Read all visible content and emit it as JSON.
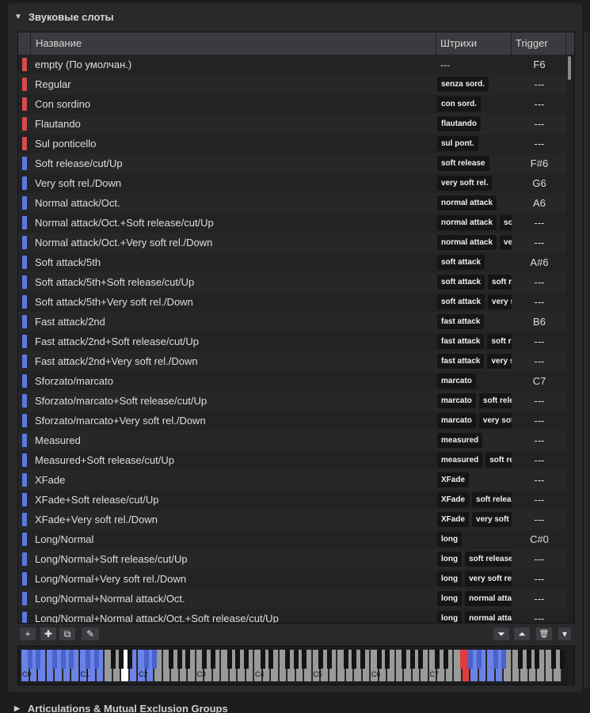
{
  "section": {
    "title": "Звуковые слоты",
    "arrow": "▼"
  },
  "table": {
    "headers": {
      "name": "Название",
      "strokes": "Штрихи",
      "trigger": "Trigger"
    },
    "rows": [
      {
        "color": "#d94a4a",
        "name": "empty (По умолчан.)",
        "strokes": [
          "---"
        ],
        "trigger": "F6"
      },
      {
        "color": "#d94a4a",
        "name": "Regular",
        "strokes": [
          "senza sord."
        ],
        "trigger": "---"
      },
      {
        "color": "#d94a4a",
        "name": "Con sordino",
        "strokes": [
          "con sord."
        ],
        "trigger": "---"
      },
      {
        "color": "#d94a4a",
        "name": "Flautando",
        "strokes": [
          "flautando"
        ],
        "trigger": "---"
      },
      {
        "color": "#d94a4a",
        "name": "Sul ponticello",
        "strokes": [
          "sul pont."
        ],
        "trigger": "---"
      },
      {
        "color": "#5b78e0",
        "name": "Soft release/cut/Up",
        "strokes": [
          "soft release"
        ],
        "trigger": "F#6"
      },
      {
        "color": "#5b78e0",
        "name": "Very soft rel./Down",
        "strokes": [
          "very soft rel."
        ],
        "trigger": "G6"
      },
      {
        "color": "#5b78e0",
        "name": "Normal attack/Oct.",
        "strokes": [
          "normal attack"
        ],
        "trigger": "A6"
      },
      {
        "color": "#5b78e0",
        "name": "Normal attack/Oct.+Soft release/cut/Up",
        "strokes": [
          "normal attack",
          "soft release"
        ],
        "trigger": "---"
      },
      {
        "color": "#5b78e0",
        "name": "Normal attack/Oct.+Very soft rel./Down",
        "strokes": [
          "normal attack",
          "very soft rel."
        ],
        "trigger": "---"
      },
      {
        "color": "#5b78e0",
        "name": "Soft attack/5th",
        "strokes": [
          "soft attack"
        ],
        "trigger": "A#6"
      },
      {
        "color": "#5b78e0",
        "name": "Soft attack/5th+Soft release/cut/Up",
        "strokes": [
          "soft attack",
          "soft release"
        ],
        "trigger": "---"
      },
      {
        "color": "#5b78e0",
        "name": "Soft attack/5th+Very soft rel./Down",
        "strokes": [
          "soft attack",
          "very soft rel."
        ],
        "trigger": "---"
      },
      {
        "color": "#5b78e0",
        "name": "Fast attack/2nd",
        "strokes": [
          "fast attack"
        ],
        "trigger": "B6"
      },
      {
        "color": "#5b78e0",
        "name": "Fast attack/2nd+Soft release/cut/Up",
        "strokes": [
          "fast attack",
          "soft release"
        ],
        "trigger": "---"
      },
      {
        "color": "#5b78e0",
        "name": "Fast attack/2nd+Very soft rel./Down",
        "strokes": [
          "fast attack",
          "very soft rel."
        ],
        "trigger": "---"
      },
      {
        "color": "#5b78e0",
        "name": "Sforzato/marcato",
        "strokes": [
          "marcato"
        ],
        "trigger": "C7"
      },
      {
        "color": "#5b78e0",
        "name": "Sforzato/marcato+Soft release/cut/Up",
        "strokes": [
          "marcato",
          "soft release"
        ],
        "trigger": "---"
      },
      {
        "color": "#5b78e0",
        "name": "Sforzato/marcato+Very soft rel./Down",
        "strokes": [
          "marcato",
          "very soft rel."
        ],
        "trigger": "---"
      },
      {
        "color": "#5b78e0",
        "name": "Measured",
        "strokes": [
          "measured"
        ],
        "trigger": "---"
      },
      {
        "color": "#5b78e0",
        "name": "Measured+Soft release/cut/Up",
        "strokes": [
          "measured",
          "soft release"
        ],
        "trigger": "---"
      },
      {
        "color": "#5b78e0",
        "name": "XFade",
        "strokes": [
          "XFade"
        ],
        "trigger": "---"
      },
      {
        "color": "#5b78e0",
        "name": "XFade+Soft release/cut/Up",
        "strokes": [
          "XFade",
          "soft release"
        ],
        "trigger": "---"
      },
      {
        "color": "#5b78e0",
        "name": "XFade+Very soft rel./Down",
        "strokes": [
          "XFade",
          "very soft rel."
        ],
        "trigger": "---"
      },
      {
        "color": "#5b78e0",
        "name": "Long/Normal",
        "strokes": [
          "long"
        ],
        "trigger": "C#0"
      },
      {
        "color": "#5b78e0",
        "name": "Long/Normal+Soft release/cut/Up",
        "strokes": [
          "long",
          "soft release"
        ],
        "trigger": "---"
      },
      {
        "color": "#5b78e0",
        "name": "Long/Normal+Very soft rel./Down",
        "strokes": [
          "long",
          "very soft rel."
        ],
        "trigger": "---"
      },
      {
        "color": "#5b78e0",
        "name": "Long/Normal+Normal attack/Oct.",
        "strokes": [
          "long",
          "normal attack"
        ],
        "trigger": "---"
      },
      {
        "color": "#5b78e0",
        "name": "Long/Normal+Normal attack/Oct.+Soft release/cut/Up",
        "strokes": [
          "long",
          "normal attack"
        ],
        "trigger": "---"
      }
    ]
  },
  "toolbar": {
    "add": "+",
    "add_multiple": "✚",
    "duplicate": "⧉",
    "edit": "✎",
    "move_down": "⏷",
    "move_up": "⏶",
    "delete": "🗑",
    "menu": "▾"
  },
  "keyboard": {
    "octaves": [
      "C0",
      "C1",
      "C2",
      "C3",
      "C4",
      "C5",
      "C6",
      "C7"
    ],
    "colors": {
      "blue": "#6b82e6",
      "red": "#e23b3b",
      "white": "#9a9a9a",
      "lit_white": "#ffffff"
    }
  },
  "collapsed_section": {
    "title": "Articulations & Mutual Exclusion Groups",
    "arrow": "▶"
  }
}
